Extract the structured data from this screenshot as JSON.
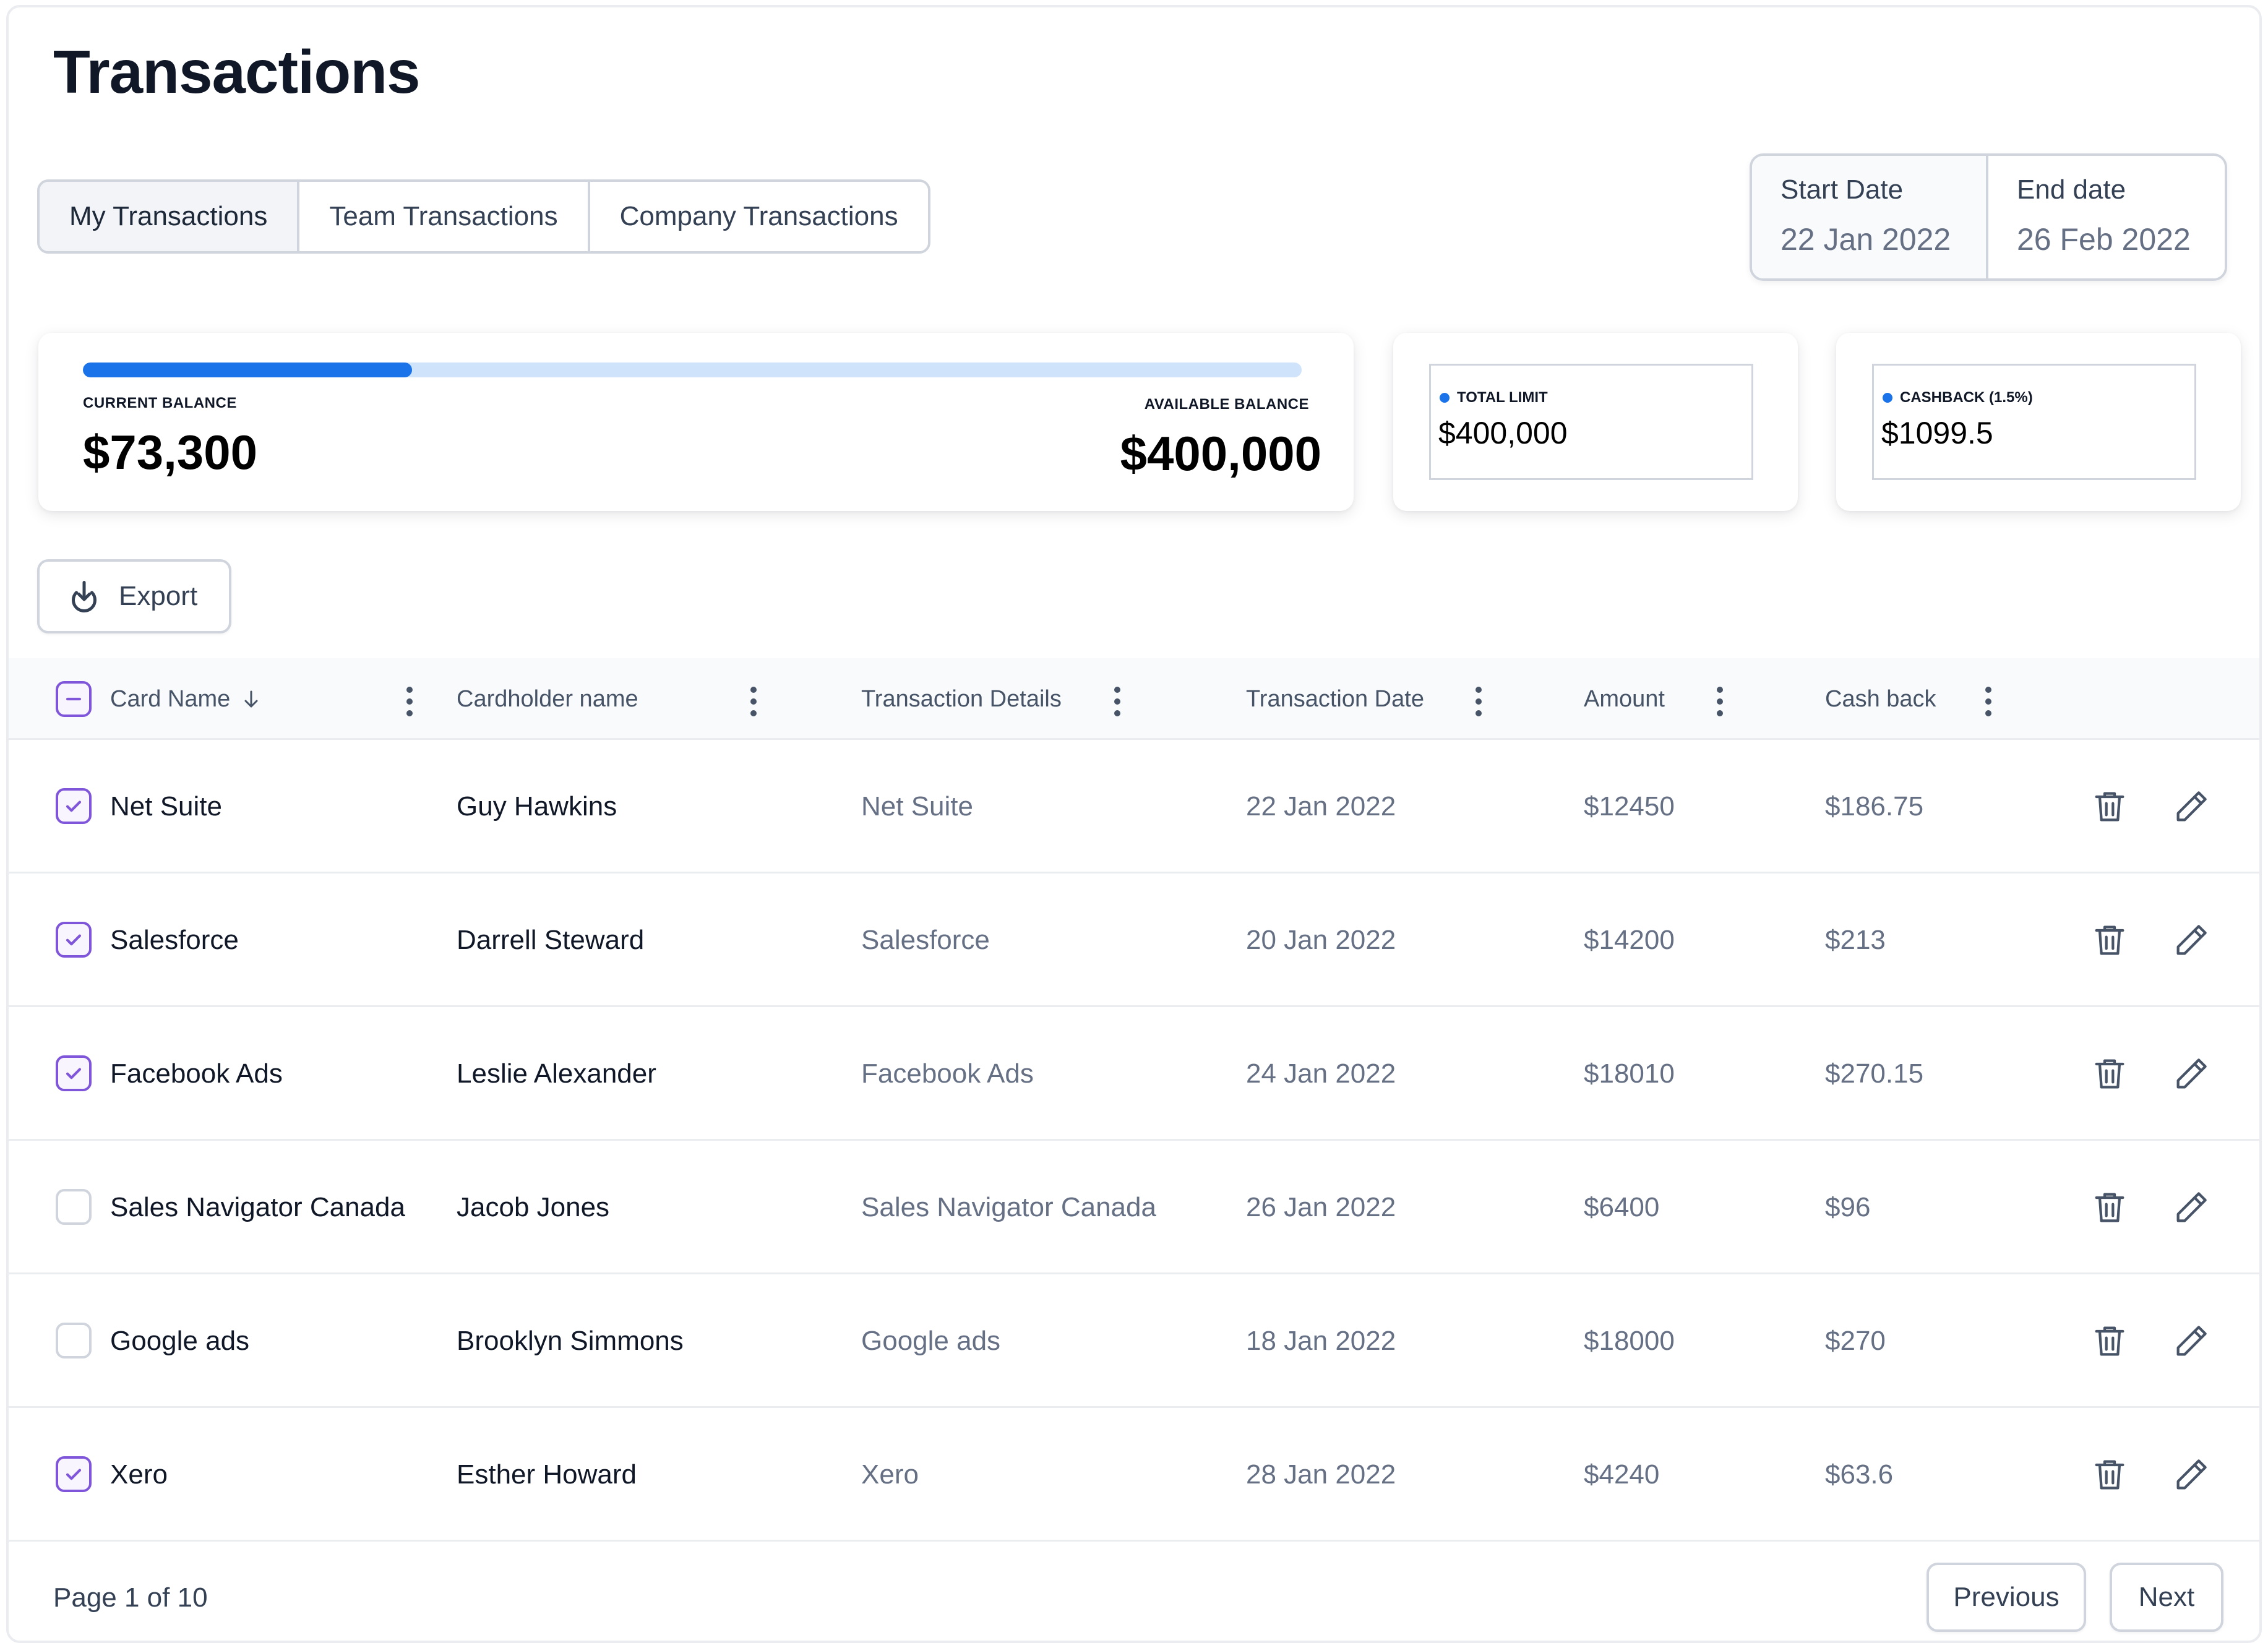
{
  "page": {
    "title": "Transactions"
  },
  "tabs": [
    {
      "label": "My Transactions",
      "active": true
    },
    {
      "label": "Team Transactions",
      "active": false
    },
    {
      "label": "Company Transactions",
      "active": false
    }
  ],
  "date_range": {
    "start_label": "Start Date",
    "start_value": "22 Jan 2022",
    "end_label": "End date",
    "end_value": "26 Feb 2022"
  },
  "balance": {
    "current_label": "CURRENT BALANCE",
    "current_value": "$73,300",
    "available_label": "AVAILABLE BALANCE",
    "available_value": "$400,000",
    "progress_fraction": 0.27
  },
  "stats": {
    "total_limit_label": "TOTAL LIMIT",
    "total_limit_value": "$400,000",
    "cashback_label": "CASHBACK (1.5%)",
    "cashback_value": "$1099.5"
  },
  "toolbar": {
    "export_label": "Export"
  },
  "table": {
    "columns": [
      "Card Name",
      "Cardholder name",
      "Transaction Details",
      "Transaction Date",
      "Amount",
      "Cash back"
    ],
    "rows": [
      {
        "checked": true,
        "card_name": "Net Suite",
        "cardholder": "Guy Hawkins",
        "details": "Net Suite",
        "date": "22 Jan 2022",
        "amount": "$12450",
        "cashback": "$186.75"
      },
      {
        "checked": true,
        "card_name": "Salesforce",
        "cardholder": "Darrell Steward",
        "details": "Salesforce",
        "date": "20 Jan 2022",
        "amount": "$14200",
        "cashback": "$213"
      },
      {
        "checked": true,
        "card_name": "Facebook Ads",
        "cardholder": "Leslie Alexander",
        "details": "Facebook Ads",
        "date": "24 Jan 2022",
        "amount": "$18010",
        "cashback": "$270.15"
      },
      {
        "checked": false,
        "card_name": "Sales Navigator Canada",
        "cardholder": "Jacob Jones",
        "details": "Sales Navigator Canada",
        "date": "26 Jan 2022",
        "amount": "$6400",
        "cashback": "$96"
      },
      {
        "checked": false,
        "card_name": "Google ads",
        "cardholder": "Brooklyn Simmons",
        "details": "Google ads",
        "date": "18 Jan 2022",
        "amount": "$18000",
        "cashback": "$270"
      },
      {
        "checked": true,
        "card_name": "Xero",
        "cardholder": "Esther Howard",
        "details": "Xero",
        "date": "28 Jan 2022",
        "amount": "$4240",
        "cashback": "$63.6"
      }
    ]
  },
  "pagination": {
    "info": "Page 1 of 10",
    "previous_label": "Previous",
    "next_label": "Next"
  },
  "colors": {
    "accent": "#1a73e8",
    "checkbox": "#7f56d9",
    "border": "#d0d5dd"
  },
  "icons": [
    "export-icon",
    "sort-down-arrow-icon",
    "kebab-menu-icon",
    "trash-icon",
    "pencil-icon",
    "checkmark-icon",
    "minus-icon"
  ]
}
